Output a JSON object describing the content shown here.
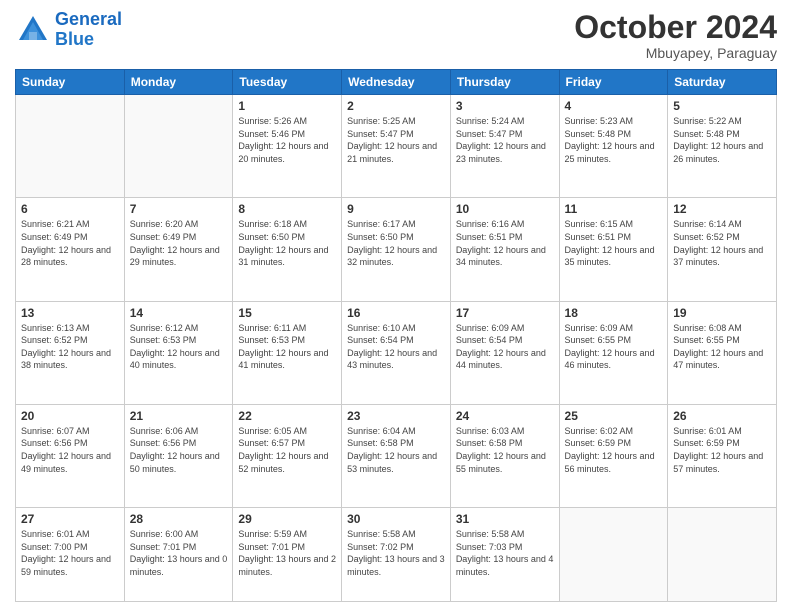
{
  "header": {
    "logo_line1": "General",
    "logo_line2": "Blue",
    "month_title": "October 2024",
    "subtitle": "Mbuyapey, Paraguay"
  },
  "weekdays": [
    "Sunday",
    "Monday",
    "Tuesday",
    "Wednesday",
    "Thursday",
    "Friday",
    "Saturday"
  ],
  "weeks": [
    [
      {
        "day": "",
        "info": ""
      },
      {
        "day": "",
        "info": ""
      },
      {
        "day": "1",
        "info": "Sunrise: 5:26 AM\nSunset: 5:46 PM\nDaylight: 12 hours and 20 minutes."
      },
      {
        "day": "2",
        "info": "Sunrise: 5:25 AM\nSunset: 5:47 PM\nDaylight: 12 hours and 21 minutes."
      },
      {
        "day": "3",
        "info": "Sunrise: 5:24 AM\nSunset: 5:47 PM\nDaylight: 12 hours and 23 minutes."
      },
      {
        "day": "4",
        "info": "Sunrise: 5:23 AM\nSunset: 5:48 PM\nDaylight: 12 hours and 25 minutes."
      },
      {
        "day": "5",
        "info": "Sunrise: 5:22 AM\nSunset: 5:48 PM\nDaylight: 12 hours and 26 minutes."
      }
    ],
    [
      {
        "day": "6",
        "info": "Sunrise: 6:21 AM\nSunset: 6:49 PM\nDaylight: 12 hours and 28 minutes."
      },
      {
        "day": "7",
        "info": "Sunrise: 6:20 AM\nSunset: 6:49 PM\nDaylight: 12 hours and 29 minutes."
      },
      {
        "day": "8",
        "info": "Sunrise: 6:18 AM\nSunset: 6:50 PM\nDaylight: 12 hours and 31 minutes."
      },
      {
        "day": "9",
        "info": "Sunrise: 6:17 AM\nSunset: 6:50 PM\nDaylight: 12 hours and 32 minutes."
      },
      {
        "day": "10",
        "info": "Sunrise: 6:16 AM\nSunset: 6:51 PM\nDaylight: 12 hours and 34 minutes."
      },
      {
        "day": "11",
        "info": "Sunrise: 6:15 AM\nSunset: 6:51 PM\nDaylight: 12 hours and 35 minutes."
      },
      {
        "day": "12",
        "info": "Sunrise: 6:14 AM\nSunset: 6:52 PM\nDaylight: 12 hours and 37 minutes."
      }
    ],
    [
      {
        "day": "13",
        "info": "Sunrise: 6:13 AM\nSunset: 6:52 PM\nDaylight: 12 hours and 38 minutes."
      },
      {
        "day": "14",
        "info": "Sunrise: 6:12 AM\nSunset: 6:53 PM\nDaylight: 12 hours and 40 minutes."
      },
      {
        "day": "15",
        "info": "Sunrise: 6:11 AM\nSunset: 6:53 PM\nDaylight: 12 hours and 41 minutes."
      },
      {
        "day": "16",
        "info": "Sunrise: 6:10 AM\nSunset: 6:54 PM\nDaylight: 12 hours and 43 minutes."
      },
      {
        "day": "17",
        "info": "Sunrise: 6:09 AM\nSunset: 6:54 PM\nDaylight: 12 hours and 44 minutes."
      },
      {
        "day": "18",
        "info": "Sunrise: 6:09 AM\nSunset: 6:55 PM\nDaylight: 12 hours and 46 minutes."
      },
      {
        "day": "19",
        "info": "Sunrise: 6:08 AM\nSunset: 6:55 PM\nDaylight: 12 hours and 47 minutes."
      }
    ],
    [
      {
        "day": "20",
        "info": "Sunrise: 6:07 AM\nSunset: 6:56 PM\nDaylight: 12 hours and 49 minutes."
      },
      {
        "day": "21",
        "info": "Sunrise: 6:06 AM\nSunset: 6:56 PM\nDaylight: 12 hours and 50 minutes."
      },
      {
        "day": "22",
        "info": "Sunrise: 6:05 AM\nSunset: 6:57 PM\nDaylight: 12 hours and 52 minutes."
      },
      {
        "day": "23",
        "info": "Sunrise: 6:04 AM\nSunset: 6:58 PM\nDaylight: 12 hours and 53 minutes."
      },
      {
        "day": "24",
        "info": "Sunrise: 6:03 AM\nSunset: 6:58 PM\nDaylight: 12 hours and 55 minutes."
      },
      {
        "day": "25",
        "info": "Sunrise: 6:02 AM\nSunset: 6:59 PM\nDaylight: 12 hours and 56 minutes."
      },
      {
        "day": "26",
        "info": "Sunrise: 6:01 AM\nSunset: 6:59 PM\nDaylight: 12 hours and 57 minutes."
      }
    ],
    [
      {
        "day": "27",
        "info": "Sunrise: 6:01 AM\nSunset: 7:00 PM\nDaylight: 12 hours and 59 minutes."
      },
      {
        "day": "28",
        "info": "Sunrise: 6:00 AM\nSunset: 7:01 PM\nDaylight: 13 hours and 0 minutes."
      },
      {
        "day": "29",
        "info": "Sunrise: 5:59 AM\nSunset: 7:01 PM\nDaylight: 13 hours and 2 minutes."
      },
      {
        "day": "30",
        "info": "Sunrise: 5:58 AM\nSunset: 7:02 PM\nDaylight: 13 hours and 3 minutes."
      },
      {
        "day": "31",
        "info": "Sunrise: 5:58 AM\nSunset: 7:03 PM\nDaylight: 13 hours and 4 minutes."
      },
      {
        "day": "",
        "info": ""
      },
      {
        "day": "",
        "info": ""
      }
    ]
  ]
}
